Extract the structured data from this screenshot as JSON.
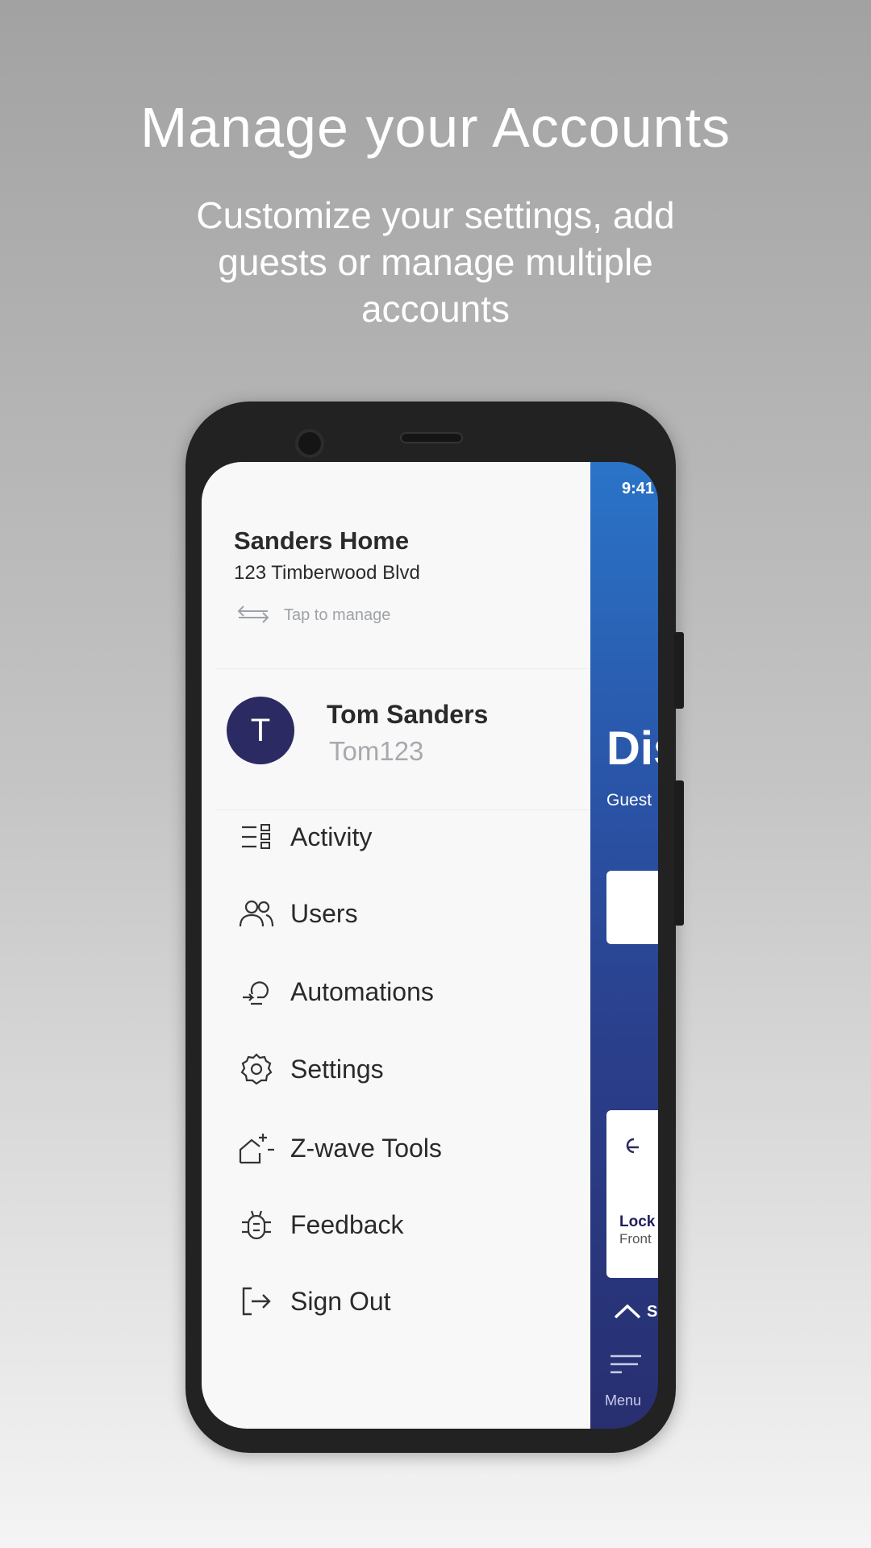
{
  "promo": {
    "title": "Manage your Accounts",
    "subtitle": "Customize your settings, add guests or manage multiple accounts"
  },
  "drawer": {
    "home": {
      "name": "Sanders Home",
      "address": "123 Timberwood Blvd",
      "manage_label": "Tap to manage"
    },
    "user": {
      "avatar_letter": "T",
      "name": "Tom Sanders",
      "username": "Tom123",
      "avatar_color": "#2b2a62"
    },
    "items": [
      {
        "label": "Activity",
        "icon": "activity-list-icon"
      },
      {
        "label": "Users",
        "icon": "users-icon"
      },
      {
        "label": "Automations",
        "icon": "automations-icon"
      },
      {
        "label": "Settings",
        "icon": "gear-icon"
      },
      {
        "label": "Z-wave Tools",
        "icon": "zwave-home-icon"
      },
      {
        "label": "Feedback",
        "icon": "bug-icon"
      },
      {
        "label": "Sign Out",
        "icon": "sign-out-icon"
      }
    ]
  },
  "background_app": {
    "time": "9:41",
    "heading": "Dis",
    "subheading": "Guest",
    "lock_card": {
      "title": "Lock",
      "subtitle": "Front"
    },
    "collapse_label": "S",
    "menu_label": "Menu",
    "accent": "#2a5bb0"
  }
}
